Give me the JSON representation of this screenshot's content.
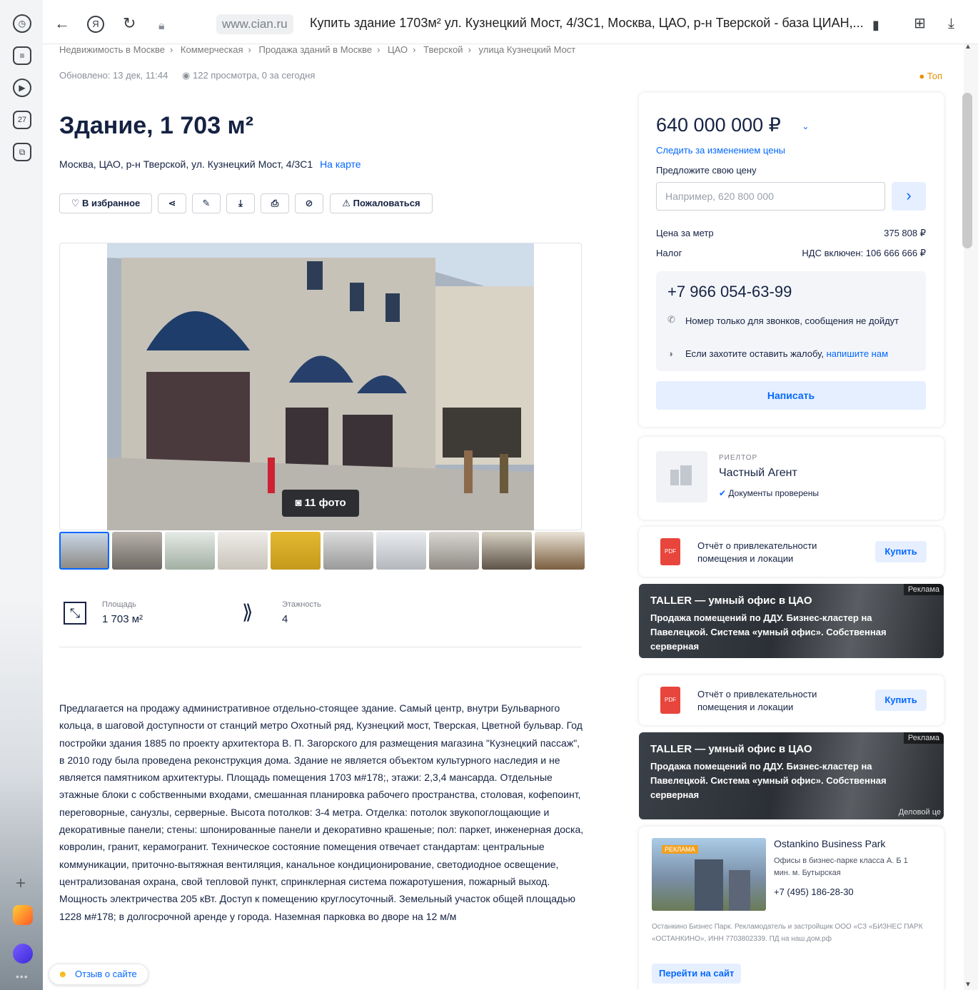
{
  "browser": {
    "url_host": "www.cian.ru",
    "tab_title": "Купить здание 1703м² ул. Кузнецкий Мост, 4/3С1, Москва, ЦАО, р-н Тверской - база ЦИАН,...",
    "sidebar_badge": "27"
  },
  "breadcrumbs": [
    "Недвижимость в Москве",
    "Коммерческая",
    "Продажа зданий в Москве",
    "ЦАО",
    "Тверской",
    "улица Кузнецкий Мост"
  ],
  "meta": {
    "updated": "Обновлено: 13 дек, 11:44",
    "views": "122 просмотра, 0 за сегодня",
    "top_label": "Топ"
  },
  "listing": {
    "title": "Здание, 1 703 м²",
    "address": "Москва, ЦАО, р-н Тверской, ул. Кузнецкий Мост, 4/3С1",
    "map_link": "На карте",
    "actions": {
      "favorite": "В избранное",
      "complain": "Пожаловаться"
    },
    "photo_count": "11 фото",
    "facts": {
      "area_label": "Площадь",
      "area_value": "1 703 м²",
      "floors_label": "Этажность",
      "floors_value": "4"
    },
    "description": "Предлагается на продажу административное отдельно-стоящее здание. Самый центр, внутри Бульварного кольца, в шаговой доступности от станций метро Охотный ряд, Кузнецкий мост, Тверская, Цветной бульвар. Год постройки здания 1885 по проекту архитектора В. П. Загорского для размещения магазина \"Кузнецкий пассаж\", в 2010 году была проведена реконструкция дома. Здание не является объектом культурного наследия и не является памятником архитектуры. Площадь помещения 1703 м#178;, этажи: 2,3,4 мансарда. Отдельные этажные блоки с собственными входами, смешанная планировка рабочего пространства, столовая, кофепоинт, переговорные, санузлы, серверные. Высота потолков: 3-4 метра. Отделка: потолок звукопоглощающие и декоративные панели; стены: шпонированные панели и декоративно крашеные; пол: паркет, инженерная доска, ковролин, гранит, керамогранит. Техническое состояние помещения отвечает стандартам: центральные коммуникации, приточно-вытяжная вентиляция, канальное кондиционирование, светодиодное освещение, централизованая охрана, свой тепловой пункт, спринклерная система пожаротушения, пожарный выход. Мощность электричества 205 кВт. Доступ к помещению круглосуточный. Земельный участок общей площадью 1228 м#178; в долгосрочной аренде у города. Наземная парковка во дворе на 12 м/м"
  },
  "review_button": "Отзыв о сайте",
  "price_card": {
    "price": "640 000 000 ₽",
    "watch_link": "Следить за изменением цены",
    "offer_label": "Предложите свою цену",
    "offer_placeholder": "Например, 620 800 000",
    "price_per_m_label": "Цена за метр",
    "price_per_m_value": "375 808 ₽",
    "tax_label": "Налог",
    "tax_value": "НДС включен: 106 666 666 ₽",
    "phone": "+7 966 054-63-99",
    "phone_note": "Номер только для звонков, сообщения не дойдут",
    "complaint_note": "Если захотите оставить жалобу,",
    "complaint_link": "напишите нам",
    "write_button": "Написать"
  },
  "agent": {
    "role": "РИЕЛТОР",
    "name": "Частный Агент",
    "verified": "Документы проверены"
  },
  "report": {
    "text": "Отчёт о привлекательности помещения и локации",
    "buy": "Купить"
  },
  "ad_banner": {
    "title": "TALLER — умный офис в ЦАО",
    "text": "Продажа помещений по ДДУ. Бизнес-кластер на Павелецкой. Система «умный офис». Собственная серверная",
    "tag": "Реклама",
    "footer": "Деловой це"
  },
  "promo": {
    "badge": "РЕКЛАМА",
    "title": "Ostankino Business Park",
    "subtitle": "Офисы в бизнес-парке класса А. Б 1 мин. м. Бутырская",
    "phone": "+7 (495) 186-28-30",
    "legal": "Останкино Бизнес Парк. Рекламодатель и застройщик ООО «СЗ «БИЗНЕС ПАРК «ОСТАНКИНО», ИНН 7703802339. ПД на наш.дом.рф",
    "cta": "Перейти на сайт"
  },
  "colors": {
    "accent": "#0468ff",
    "accent_bg": "#e6efff",
    "text": "#152242",
    "pdf_red": "#e8453c",
    "top_orange": "#e88f00"
  }
}
